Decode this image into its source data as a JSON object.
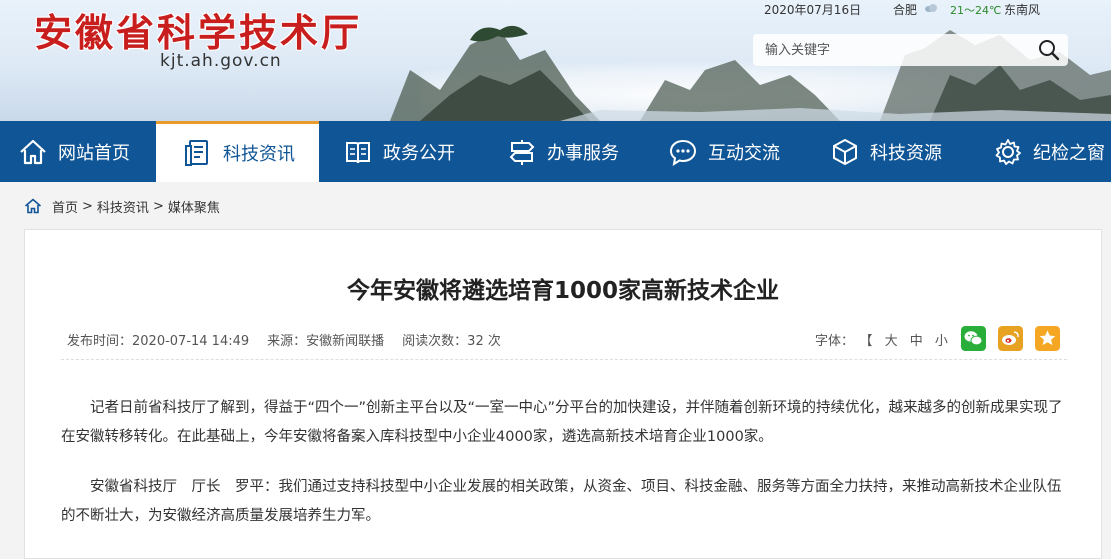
{
  "header": {
    "site_title": "安徽省科学技术厅",
    "site_domain": "kjt.ah.gov.cn",
    "date": "2020年07月16日",
    "city": "合肥",
    "temperature": "21～24℃",
    "wind": "东南风",
    "search": {
      "placeholder": "输入关键字"
    }
  },
  "nav": {
    "items": [
      {
        "label": "网站首页",
        "icon": "home-icon"
      },
      {
        "label": "科技资讯",
        "icon": "document-icon",
        "active": true
      },
      {
        "label": "政务公开",
        "icon": "book-icon"
      },
      {
        "label": "办事服务",
        "icon": "signpost-icon"
      },
      {
        "label": "互动交流",
        "icon": "chat-icon"
      },
      {
        "label": "科技资源",
        "icon": "cube-icon"
      },
      {
        "label": "纪检之窗",
        "icon": "gear-icon"
      }
    ]
  },
  "breadcrumb": {
    "items": [
      "首页",
      "科技资讯",
      "媒体聚焦"
    ],
    "separator": ">"
  },
  "article": {
    "title": "今年安徽将遴选培育1000家高新技术企业",
    "publish_time": "发布时间：2020-07-14 14:49",
    "source": "来源：安徽新闻联播",
    "views": "阅读次数：32 次",
    "font_label": "字体：",
    "font_options": "【 大 中 小 】",
    "share": [
      {
        "icon": "wechat-icon",
        "color": "#2aae3a"
      },
      {
        "icon": "weibo-icon",
        "color": "#e8a221"
      },
      {
        "icon": "favorite-star-icon",
        "color": "#f5a623"
      }
    ],
    "paragraphs": [
      "记者日前省科技厅了解到，得益于“四个一”创新主平台以及“一室一中心”分平台的加快建设，并伴随着创新环境的持续优化，越来越多的创新成果实现了在安徽转移转化。在此基础上，今年安徽将备案入库科技型中小企业4000家，遴选高新技术培育企业1000家。",
      "安徽省科技厅　厅长　罗平：我们通过支持科技型中小企业发展的相关政策，从资金、项目、科技金融、服务等方面全力扶持，来推动高新技术企业队伍的不断壮大，为安徽经济高质量发展培养生力军。"
    ]
  },
  "colors": {
    "brand_red": "#c81e1e",
    "nav_blue": "#105595",
    "active_accent": "#e89a2a"
  }
}
